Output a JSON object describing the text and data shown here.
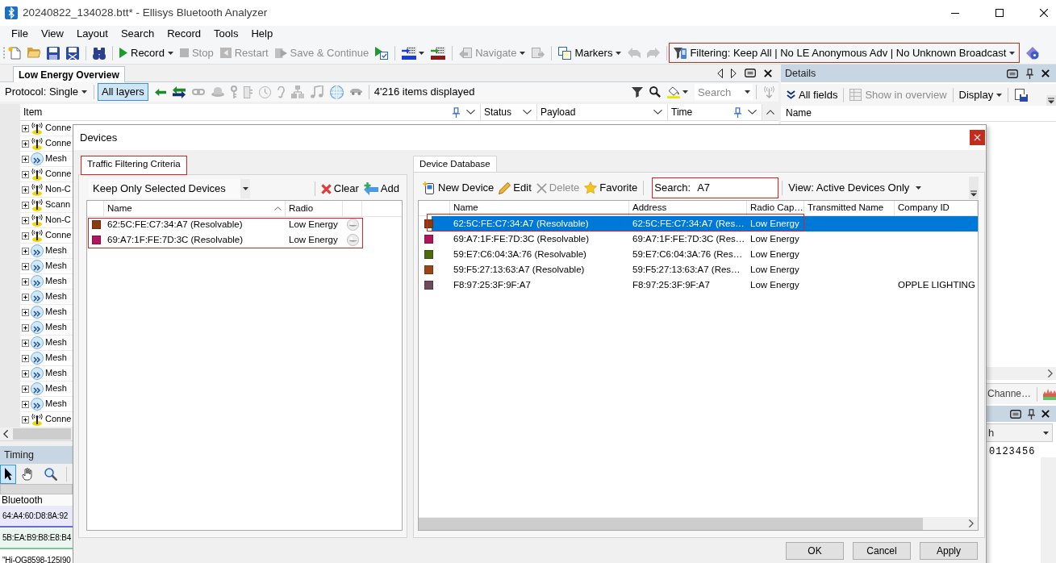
{
  "window": {
    "title": "20240822_134028.btt* - Ellisys Bluetooth Analyzer"
  },
  "menu": [
    "File",
    "View",
    "Layout",
    "Search",
    "Record",
    "Tools",
    "Help"
  ],
  "toolbar": [
    {
      "label": "Record",
      "disabled": false,
      "dropdown": true,
      "highlighted": false
    },
    {
      "label": "Stop",
      "disabled": true,
      "dropdown": false,
      "highlighted": false
    },
    {
      "label": "Restart",
      "disabled": true,
      "dropdown": false,
      "highlighted": false
    },
    {
      "label": "Save & Continue",
      "disabled": true,
      "dropdown": false,
      "highlighted": false
    },
    {
      "label": "Navigate",
      "disabled": true,
      "dropdown": true,
      "highlighted": false
    },
    {
      "label": "Markers",
      "disabled": false,
      "dropdown": true,
      "highlighted": false
    },
    {
      "label": "Filtering: Keep All | No LE Anonymous Adv | No Unknown Broadcast",
      "disabled": false,
      "dropdown": true,
      "highlighted": true
    }
  ],
  "overview": {
    "tabs": [
      {
        "label": "Low Energy Overview",
        "selected": true
      }
    ],
    "protocol": "Protocol: Single",
    "layers": {
      "label": "All layers",
      "selected": true
    },
    "count": "4'216 items displayed",
    "search": {
      "placeholder": "Search"
    },
    "columns": [
      {
        "label": "Item",
        "pinned": true
      },
      {
        "label": "Status",
        "pinned": false
      },
      {
        "label": "Payload",
        "pinned": false
      },
      {
        "label": "Time",
        "pinned": true
      }
    ],
    "rows": [
      {
        "label": "Conne",
        "kind": "connection"
      },
      {
        "label": "Conne",
        "kind": "connection"
      },
      {
        "label": "Mesh",
        "kind": "mesh"
      },
      {
        "label": "Conne",
        "kind": "connection"
      },
      {
        "label": "Non-C",
        "kind": "connection"
      },
      {
        "label": "Scann",
        "kind": "connection"
      },
      {
        "label": "Non-C",
        "kind": "connection"
      },
      {
        "label": "Conne",
        "kind": "connection"
      },
      {
        "label": "Mesh",
        "kind": "mesh"
      },
      {
        "label": "Mesh",
        "kind": "mesh"
      },
      {
        "label": "Mesh",
        "kind": "mesh"
      },
      {
        "label": "Mesh",
        "kind": "mesh"
      },
      {
        "label": "Mesh",
        "kind": "mesh"
      },
      {
        "label": "Mesh",
        "kind": "mesh"
      },
      {
        "label": "Mesh",
        "kind": "mesh"
      },
      {
        "label": "Mesh",
        "kind": "mesh"
      },
      {
        "label": "Mesh",
        "kind": "mesh"
      },
      {
        "label": "Mesh",
        "kind": "mesh"
      },
      {
        "label": "Mesh",
        "kind": "mesh"
      },
      {
        "label": "Conne",
        "kind": "connection"
      }
    ]
  },
  "timing": {
    "title": "Timing",
    "tools": [
      {
        "selected": true
      },
      {
        "selected": false
      },
      {
        "selected": false
      }
    ],
    "track": "Bluetooth",
    "rows": [
      {
        "label": "64:A4:60:D8:8A:92",
        "color": "#6b6bd6"
      },
      {
        "label": "5B:EA:B9:B8:E8:B4",
        "color": "#7cc59a"
      },
      {
        "label": "\"Hi-OG8598-125I90"
      }
    ]
  },
  "details": {
    "title": "Details",
    "toolbar": [
      {
        "label": "All fields",
        "disabled": false,
        "dropdown": false
      },
      {
        "label": "Show in overview",
        "disabled": true,
        "dropdown": false
      },
      {
        "label": "Display",
        "disabled": false,
        "dropdown": true
      }
    ],
    "columns": [
      "Name"
    ],
    "tabs": [
      {
        "label": "Channe…"
      }
    ],
    "field": {
      "value": "h"
    },
    "hex_header": "0123456"
  },
  "devices_dialog": {
    "title": "Devices",
    "criteria": {
      "tabs": [
        {
          "label": "Traffic Filtering Criteria",
          "selected": true,
          "highlighted": true
        }
      ],
      "mode": "Keep Only Selected Devices",
      "actions": [
        {
          "label": "Clear"
        },
        {
          "label": "Add"
        }
      ],
      "columns": [
        {
          "label": "Name",
          "sorted": true
        },
        {
          "label": "Radio",
          "sorted": false
        }
      ],
      "rows_highlighted": true,
      "rows": [
        {
          "name": "62:5C:FE:C7:34:A7 (Resolvable)",
          "radio": "Low Energy",
          "color": "#8c3b10"
        },
        {
          "name": "69:A7:1F:FE:7D:3C (Resolvable)",
          "radio": "Low Energy",
          "color": "#b0155c"
        }
      ]
    },
    "database": {
      "tabs": [
        {
          "label": "Device Database",
          "selected": true
        }
      ],
      "actions": [
        {
          "label": "New Device",
          "disabled": false
        },
        {
          "label": "Edit",
          "disabled": false
        },
        {
          "label": "Delete",
          "disabled": true
        },
        {
          "label": "Favorite",
          "disabled": false
        }
      ],
      "search": {
        "label": "Search:",
        "value": "A7",
        "highlighted": true
      },
      "view": "View: Active Devices Only",
      "columns": [
        "Name",
        "Address",
        "Radio Cap…",
        "Transmitted Name",
        "Company ID"
      ],
      "rows": [
        {
          "name": "62:5C:FE:C7:34:A7 (Resolvable)",
          "address": "62:5C:FE:C7:34:A7 (Res…",
          "radio": "Low Energy",
          "color": "#8c3b10",
          "selected": true,
          "highlighted": true
        },
        {
          "name": "69:A7:1F:FE:7D:3C (Resolvable)",
          "address": "69:A7:1F:FE:7D:3C (Res…",
          "radio": "Low Energy",
          "color": "#b0155c",
          "selected": false,
          "highlighted": false
        },
        {
          "name": "59:E7:C6:04:3A:76 (Resolvable)",
          "address": "59:E7:C6:04:3A:76 (Res…",
          "radio": "Low Energy",
          "color": "#4e6a10",
          "selected": false,
          "highlighted": false
        },
        {
          "name": "59:F5:27:13:63:A7 (Resolvable)",
          "address": "59:F5:27:13:63:A7 (Res…",
          "radio": "Low Energy",
          "color": "#9a4513",
          "selected": false,
          "highlighted": false
        },
        {
          "name": "F8:97:25:3F:9F:A7",
          "address": "F8:97:25:3F:9F:A7",
          "radio": "Low Energy",
          "company": "OPPLE LIGHTING",
          "color": "#6e4a5c",
          "selected": false,
          "highlighted": false
        }
      ]
    },
    "buttons": [
      "OK",
      "Cancel",
      "Apply"
    ]
  }
}
